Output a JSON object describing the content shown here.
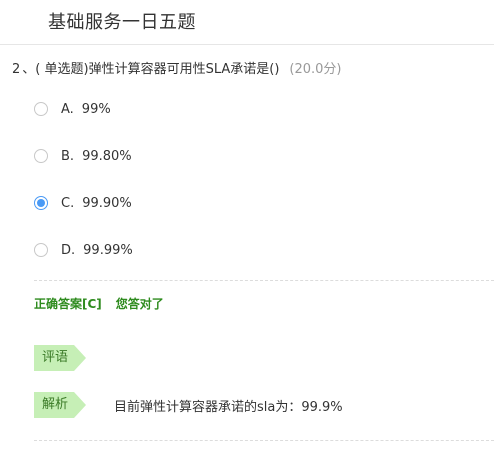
{
  "header": {
    "title": "基础服务一日五题"
  },
  "question": {
    "number": "2",
    "separator": "、",
    "text": "( 单选题)弹性计算容器可用性SLA承诺是()",
    "score": "(20.0分)"
  },
  "options": [
    {
      "letter": "A.",
      "text": "99%",
      "selected": false
    },
    {
      "letter": "B.",
      "text": "99.80%",
      "selected": false
    },
    {
      "letter": "C.",
      "text": "99.90%",
      "selected": true
    },
    {
      "letter": "D.",
      "text": "99.99%",
      "selected": false
    }
  ],
  "result": {
    "correct_answer_label": "正确答案[C]",
    "message": "您答对了"
  },
  "comment": {
    "label": "评语"
  },
  "analysis": {
    "label": "解析",
    "text": "目前弹性计算容器承诺的sla为：99.9%"
  },
  "colors": {
    "accent": "#4a9af5",
    "correct_text": "#2e8b1e",
    "tag_bg": "#c6efb6",
    "tag_text": "#3a7a26"
  }
}
